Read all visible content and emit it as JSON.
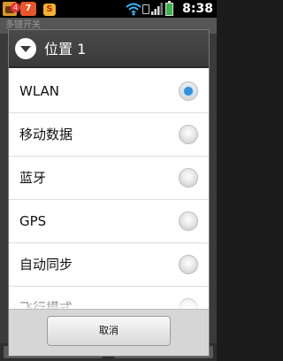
{
  "status_bar": {
    "time": "8:38",
    "notification_badge": "4",
    "app_icon_b_text": "7",
    "app_icon_b_badge": "7",
    "app_icon_c_text": "S"
  },
  "background_app": {
    "title": "多键开关"
  },
  "dialog": {
    "title": "位置 1",
    "options": [
      {
        "label": "WLAN",
        "selected": true
      },
      {
        "label": "移动数据",
        "selected": false
      },
      {
        "label": "蓝牙",
        "selected": false
      },
      {
        "label": "GPS",
        "selected": false
      },
      {
        "label": "自动同步",
        "selected": false
      },
      {
        "label": "飞行模式",
        "selected": false
      }
    ],
    "cancel_label": "取消"
  },
  "colors": {
    "radio_selected": "#2f8fe0",
    "header_bg": "#3a3a3a"
  }
}
